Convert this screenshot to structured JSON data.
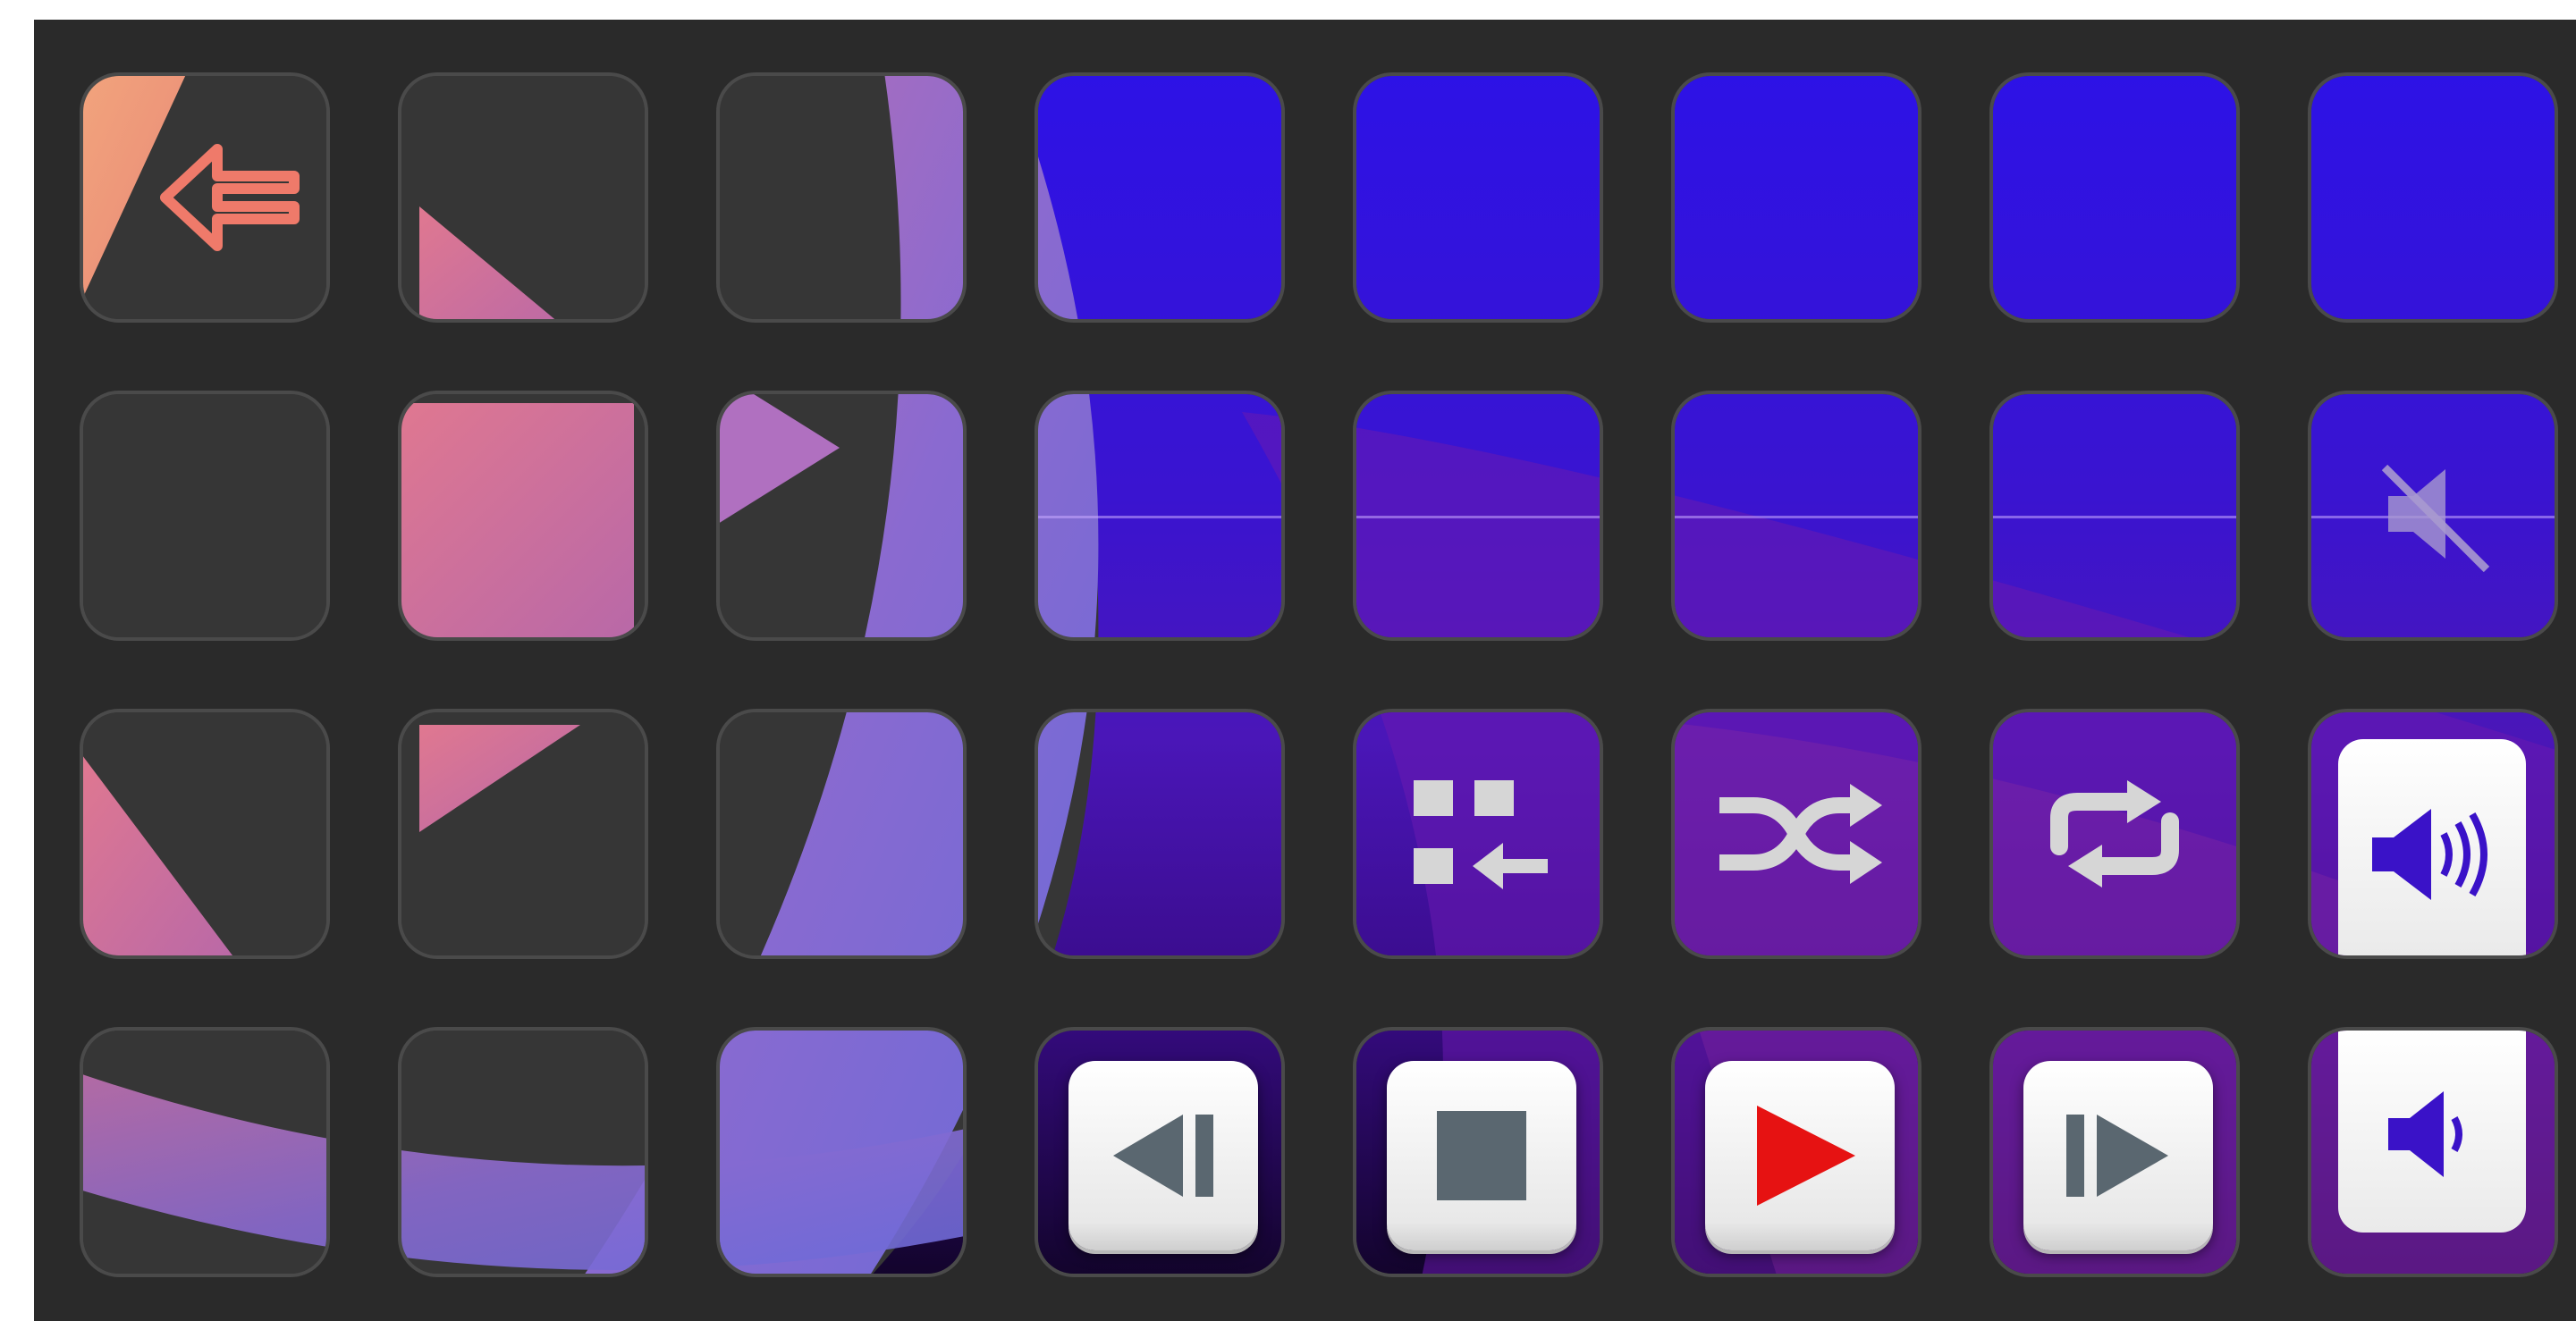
{
  "app": {
    "title": "",
    "grid": {
      "rows": 4,
      "columns": 8
    }
  },
  "colors": {
    "frame": "#2a2a2a",
    "key_border": "#4a4a4a",
    "key_dark": "#363636",
    "blue": "#3010d8",
    "violet": "#5a1eb0",
    "pink": "#d46a9a",
    "peach": "#f0a080",
    "deep": "#140628",
    "play_red": "#e61212",
    "media_gray": "#5a6770",
    "speaker_blue": "#3a12c8"
  },
  "keys": [
    {
      "id": "back",
      "icon": "back-arrow-icon"
    },
    {
      "id": "previous",
      "icon": "previous-track-icon"
    },
    {
      "id": "stop",
      "icon": "stop-icon"
    },
    {
      "id": "play",
      "icon": "play-icon"
    },
    {
      "id": "next",
      "icon": "next-track-icon"
    },
    {
      "id": "add-to-queue",
      "icon": "add-to-queue-icon"
    },
    {
      "id": "shuffle",
      "icon": "shuffle-icon"
    },
    {
      "id": "repeat",
      "icon": "repeat-icon"
    },
    {
      "id": "mute",
      "icon": "mute-icon"
    },
    {
      "id": "volume-up",
      "icon": "volume-up-icon"
    },
    {
      "id": "volume-down",
      "icon": "volume-down-icon"
    }
  ]
}
